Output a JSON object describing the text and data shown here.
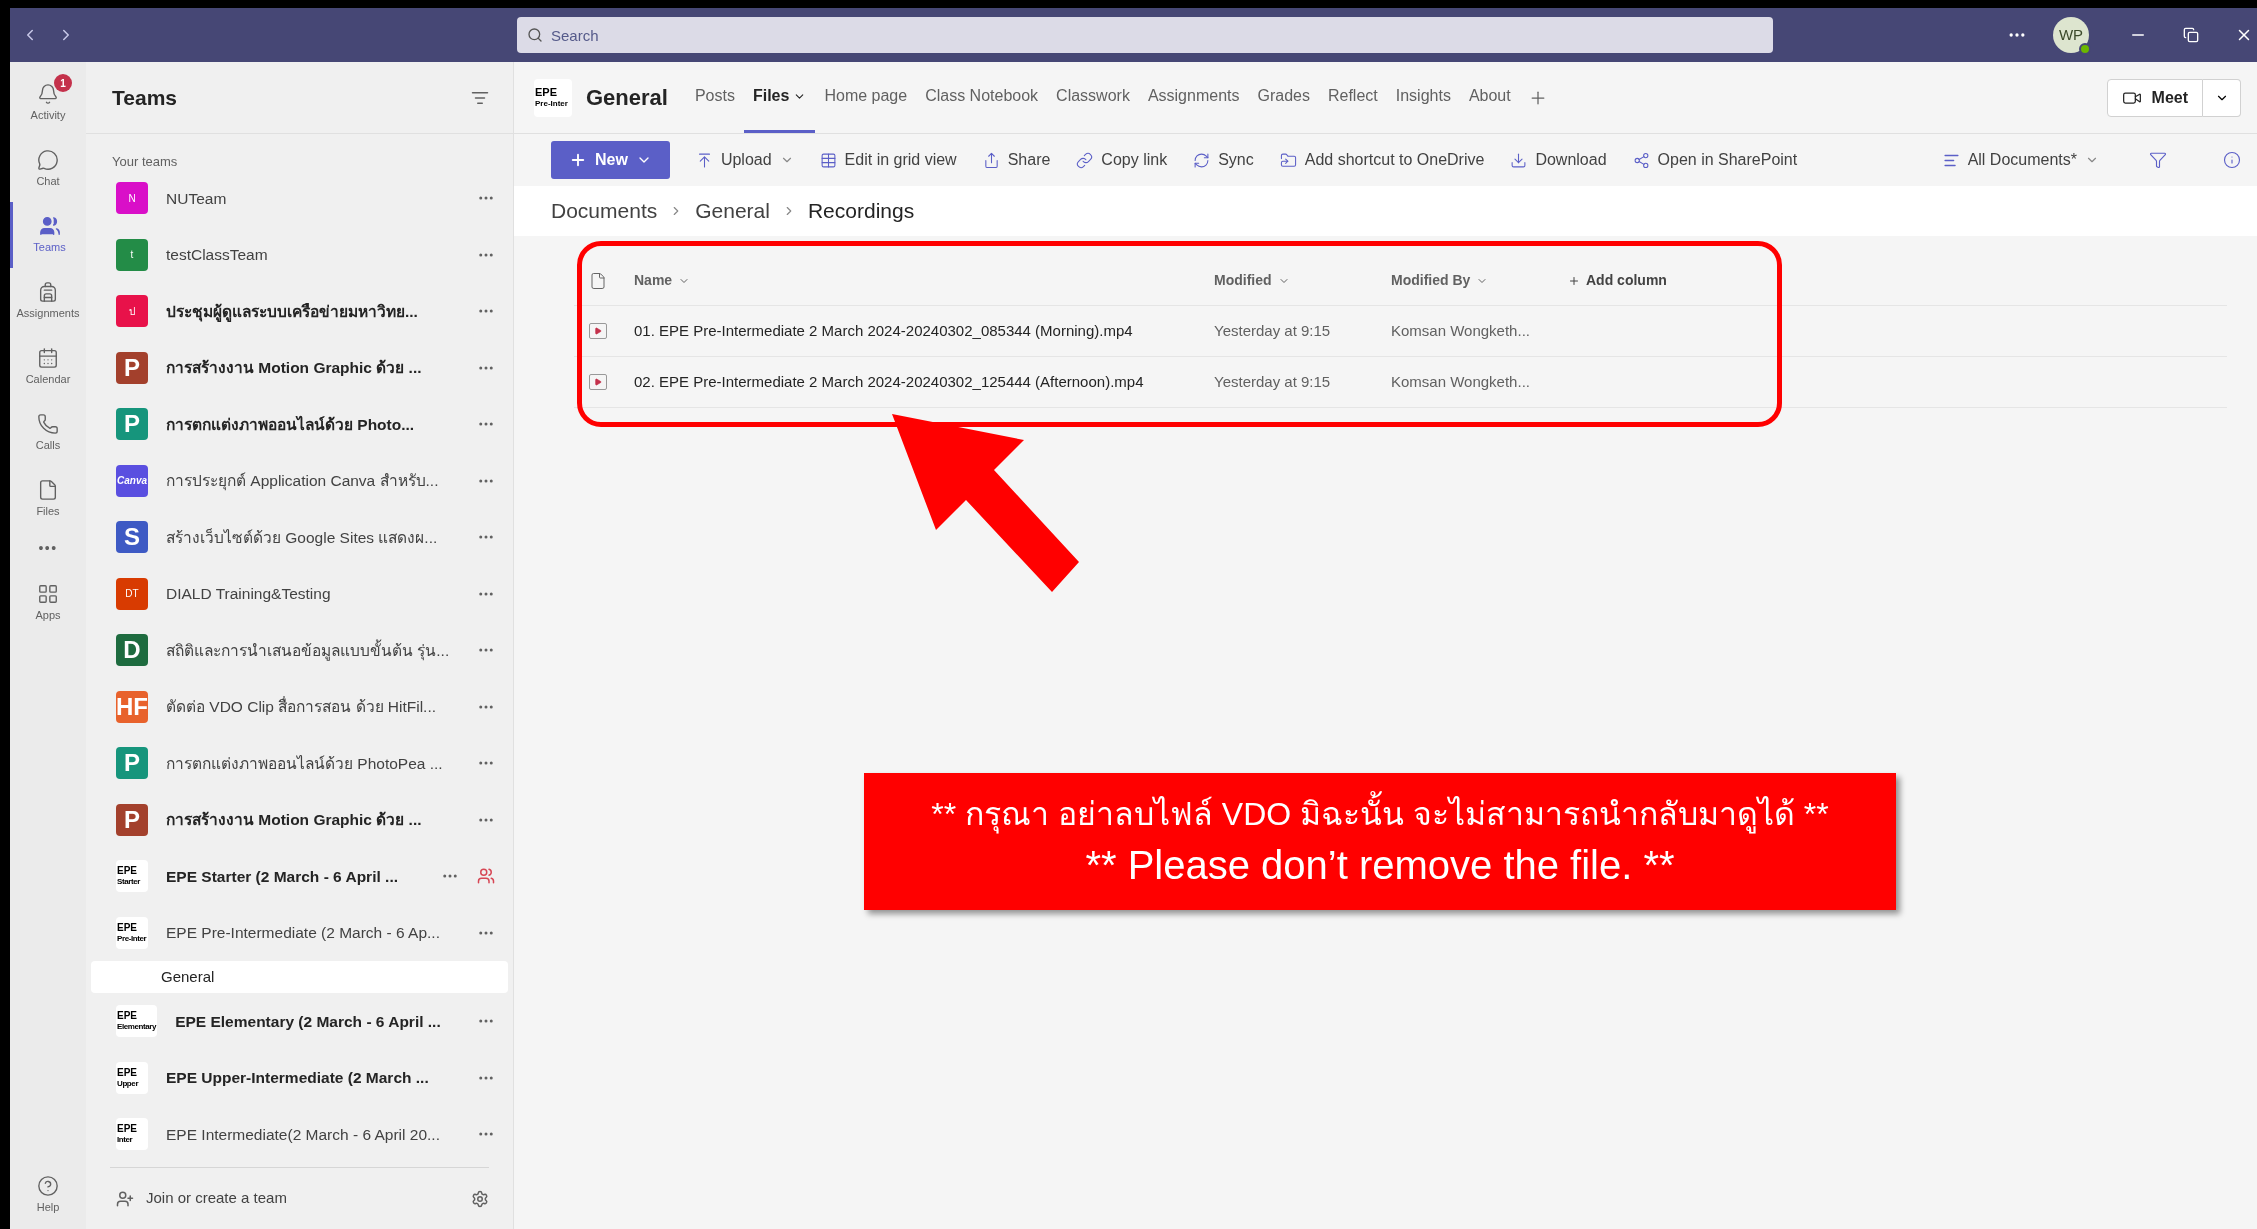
{
  "window": {
    "search": {
      "placeholder": "Search"
    },
    "avatar": "WP"
  },
  "rail": {
    "items": [
      {
        "label": "Activity",
        "selected": false,
        "badge": "1"
      },
      {
        "label": "Chat",
        "selected": false
      },
      {
        "label": "Teams",
        "selected": true
      },
      {
        "label": "Assignments",
        "selected": false
      },
      {
        "label": "Calendar",
        "selected": false
      },
      {
        "label": "Calls",
        "selected": false
      },
      {
        "label": "Files",
        "selected": false
      }
    ],
    "more": "•••",
    "apps": "Apps",
    "help": "Help"
  },
  "teams_panel": {
    "title": "Teams",
    "section": "Your teams",
    "teams": [
      {
        "name": "NUTeam",
        "unread": false,
        "meeting": false,
        "avatar": {
          "kind": "letter",
          "text": "N",
          "color": "#d90fc8"
        }
      },
      {
        "name": "testClassTeam",
        "unread": false,
        "meeting": false,
        "avatar": {
          "kind": "letter",
          "text": "t",
          "color": "#238c47"
        }
      },
      {
        "name": "ประชุมผู้ดูแลระบบเครือข่ายมหาวิทย...",
        "unread": true,
        "meeting": false,
        "avatar": {
          "kind": "letter",
          "text": "ป",
          "color": "#e8124a"
        }
      },
      {
        "name": "การสร้างงาน Motion Graphic ด้วย ...",
        "unread": true,
        "meeting": false,
        "avatar": {
          "kind": "logo",
          "text": "P",
          "color": "#a3402c"
        }
      },
      {
        "name": "การตกแต่งภาพออนไลน์ด้วย Photo...",
        "unread": true,
        "meeting": false,
        "avatar": {
          "kind": "logo",
          "text": "P",
          "color": "#16957c"
        }
      },
      {
        "name": "การประยุกต์ Application Canva สำหรับ...",
        "unread": false,
        "meeting": false,
        "avatar": {
          "kind": "script",
          "text": "Canva",
          "color": "#5a4fe0"
        }
      },
      {
        "name": "สร้างเว็บไซต์ด้วย Google Sites แสดงผ...",
        "unread": false,
        "meeting": false,
        "avatar": {
          "kind": "logo",
          "text": "S",
          "color": "#3e5ac4"
        }
      },
      {
        "name": "DIALD Training&Testing",
        "unread": false,
        "meeting": false,
        "avatar": {
          "kind": "letter",
          "text": "DT",
          "color": "#d83b01"
        }
      },
      {
        "name": "สถิติและการนำเสนอข้อมูลแบบขั้นต้น รุ่น...",
        "unread": false,
        "meeting": false,
        "avatar": {
          "kind": "logo",
          "text": "D",
          "color": "#1e6b3f"
        }
      },
      {
        "name": "ตัดต่อ VDO Clip สื่อการสอน ด้วย HitFil...",
        "unread": false,
        "meeting": false,
        "avatar": {
          "kind": "logo",
          "text": "HF",
          "color": "#e8622c"
        }
      },
      {
        "name": "การตกแต่งภาพออนไลน์ด้วย PhotoPea ...",
        "unread": false,
        "meeting": false,
        "avatar": {
          "kind": "logo",
          "text": "P",
          "color": "#16957c"
        }
      },
      {
        "name": "การสร้างงาน Motion Graphic ด้วย ...",
        "unread": true,
        "meeting": false,
        "avatar": {
          "kind": "logo",
          "text": "P",
          "color": "#a3402c"
        }
      },
      {
        "name": "EPE Starter (2 March - 6 April ...",
        "unread": true,
        "meeting": true,
        "avatar": {
          "kind": "epe",
          "text": "EPE",
          "sub": "Starter",
          "color": "#ffffff"
        }
      },
      {
        "name": "EPE Pre-Intermediate (2 March - 6 Ap...",
        "unread": false,
        "meeting": false,
        "avatar": {
          "kind": "epe",
          "text": "EPE",
          "sub": "Pre-Inter",
          "color": "#ffffff"
        },
        "children": [
          {
            "name": "General",
            "selected": true
          }
        ]
      },
      {
        "name": "EPE Elementary (2 March - 6 April ...",
        "unread": true,
        "meeting": false,
        "avatar": {
          "kind": "epe",
          "text": "EPE",
          "sub": "Elementary",
          "color": "#ffffff"
        }
      },
      {
        "name": "EPE Upper-Intermediate (2 March ...",
        "unread": true,
        "meeting": false,
        "avatar": {
          "kind": "epe",
          "text": "EPE",
          "sub": "Upper",
          "color": "#ffffff"
        }
      },
      {
        "name": "EPE Intermediate(2 March - 6 April 20...",
        "unread": false,
        "meeting": false,
        "avatar": {
          "kind": "epe",
          "text": "EPE",
          "sub": "Inter",
          "color": "#ffffff"
        }
      }
    ],
    "join": "Join or create a team"
  },
  "channel": {
    "logo": [
      "EPE",
      "Pre-Inter"
    ],
    "title": "General",
    "tabs": [
      {
        "label": "Posts",
        "selected": false,
        "dropdown": false
      },
      {
        "label": "Files",
        "selected": true,
        "dropdown": true
      },
      {
        "label": "Home page",
        "selected": false,
        "dropdown": false
      },
      {
        "label": "Class Notebook",
        "selected": false,
        "dropdown": false
      },
      {
        "label": "Classwork",
        "selected": false,
        "dropdown": false
      },
      {
        "label": "Assignments",
        "selected": false,
        "dropdown": false
      },
      {
        "label": "Grades",
        "selected": false,
        "dropdown": false
      },
      {
        "label": "Reflect",
        "selected": false,
        "dropdown": false
      },
      {
        "label": "Insights",
        "selected": false,
        "dropdown": false
      },
      {
        "label": "About",
        "selected": false,
        "dropdown": false
      }
    ],
    "meet": "Meet"
  },
  "toolbar": {
    "new": "New",
    "actions": [
      {
        "label": "Upload",
        "dropdown": true
      },
      {
        "label": "Edit in grid view",
        "dropdown": false
      },
      {
        "label": "Share",
        "dropdown": false
      },
      {
        "label": "Copy link",
        "dropdown": false
      },
      {
        "label": "Sync",
        "dropdown": false
      },
      {
        "label": "Add shortcut to OneDrive",
        "dropdown": false
      },
      {
        "label": "Download",
        "dropdown": false
      },
      {
        "label": "Open in SharePoint",
        "dropdown": false
      }
    ],
    "view": "All Documents*"
  },
  "breadcrumb": [
    "Documents",
    "General",
    "Recordings"
  ],
  "files": {
    "columns": [
      "Name",
      "Modified",
      "Modified By"
    ],
    "add_column": "Add column",
    "rows": [
      {
        "name": "01. EPE Pre-Intermediate 2 March 2024-20240302_085344 (Morning).mp4",
        "modified": "Yesterday at 9:15",
        "modified_by": "Komsan Wongketh..."
      },
      {
        "name": "02. EPE Pre-Intermediate 2 March 2024-20240302_125444 (Afternoon).mp4",
        "modified": "Yesterday at 9:15",
        "modified_by": "Komsan Wongketh..."
      }
    ]
  },
  "banner": {
    "lines": [
      "** กรุณา อย่าลบไฟล์ VDO มิฉะนั้น จะไม่สามารถนำกลับมาดูได้ **",
      "** Please don’t remove the file. **"
    ]
  }
}
